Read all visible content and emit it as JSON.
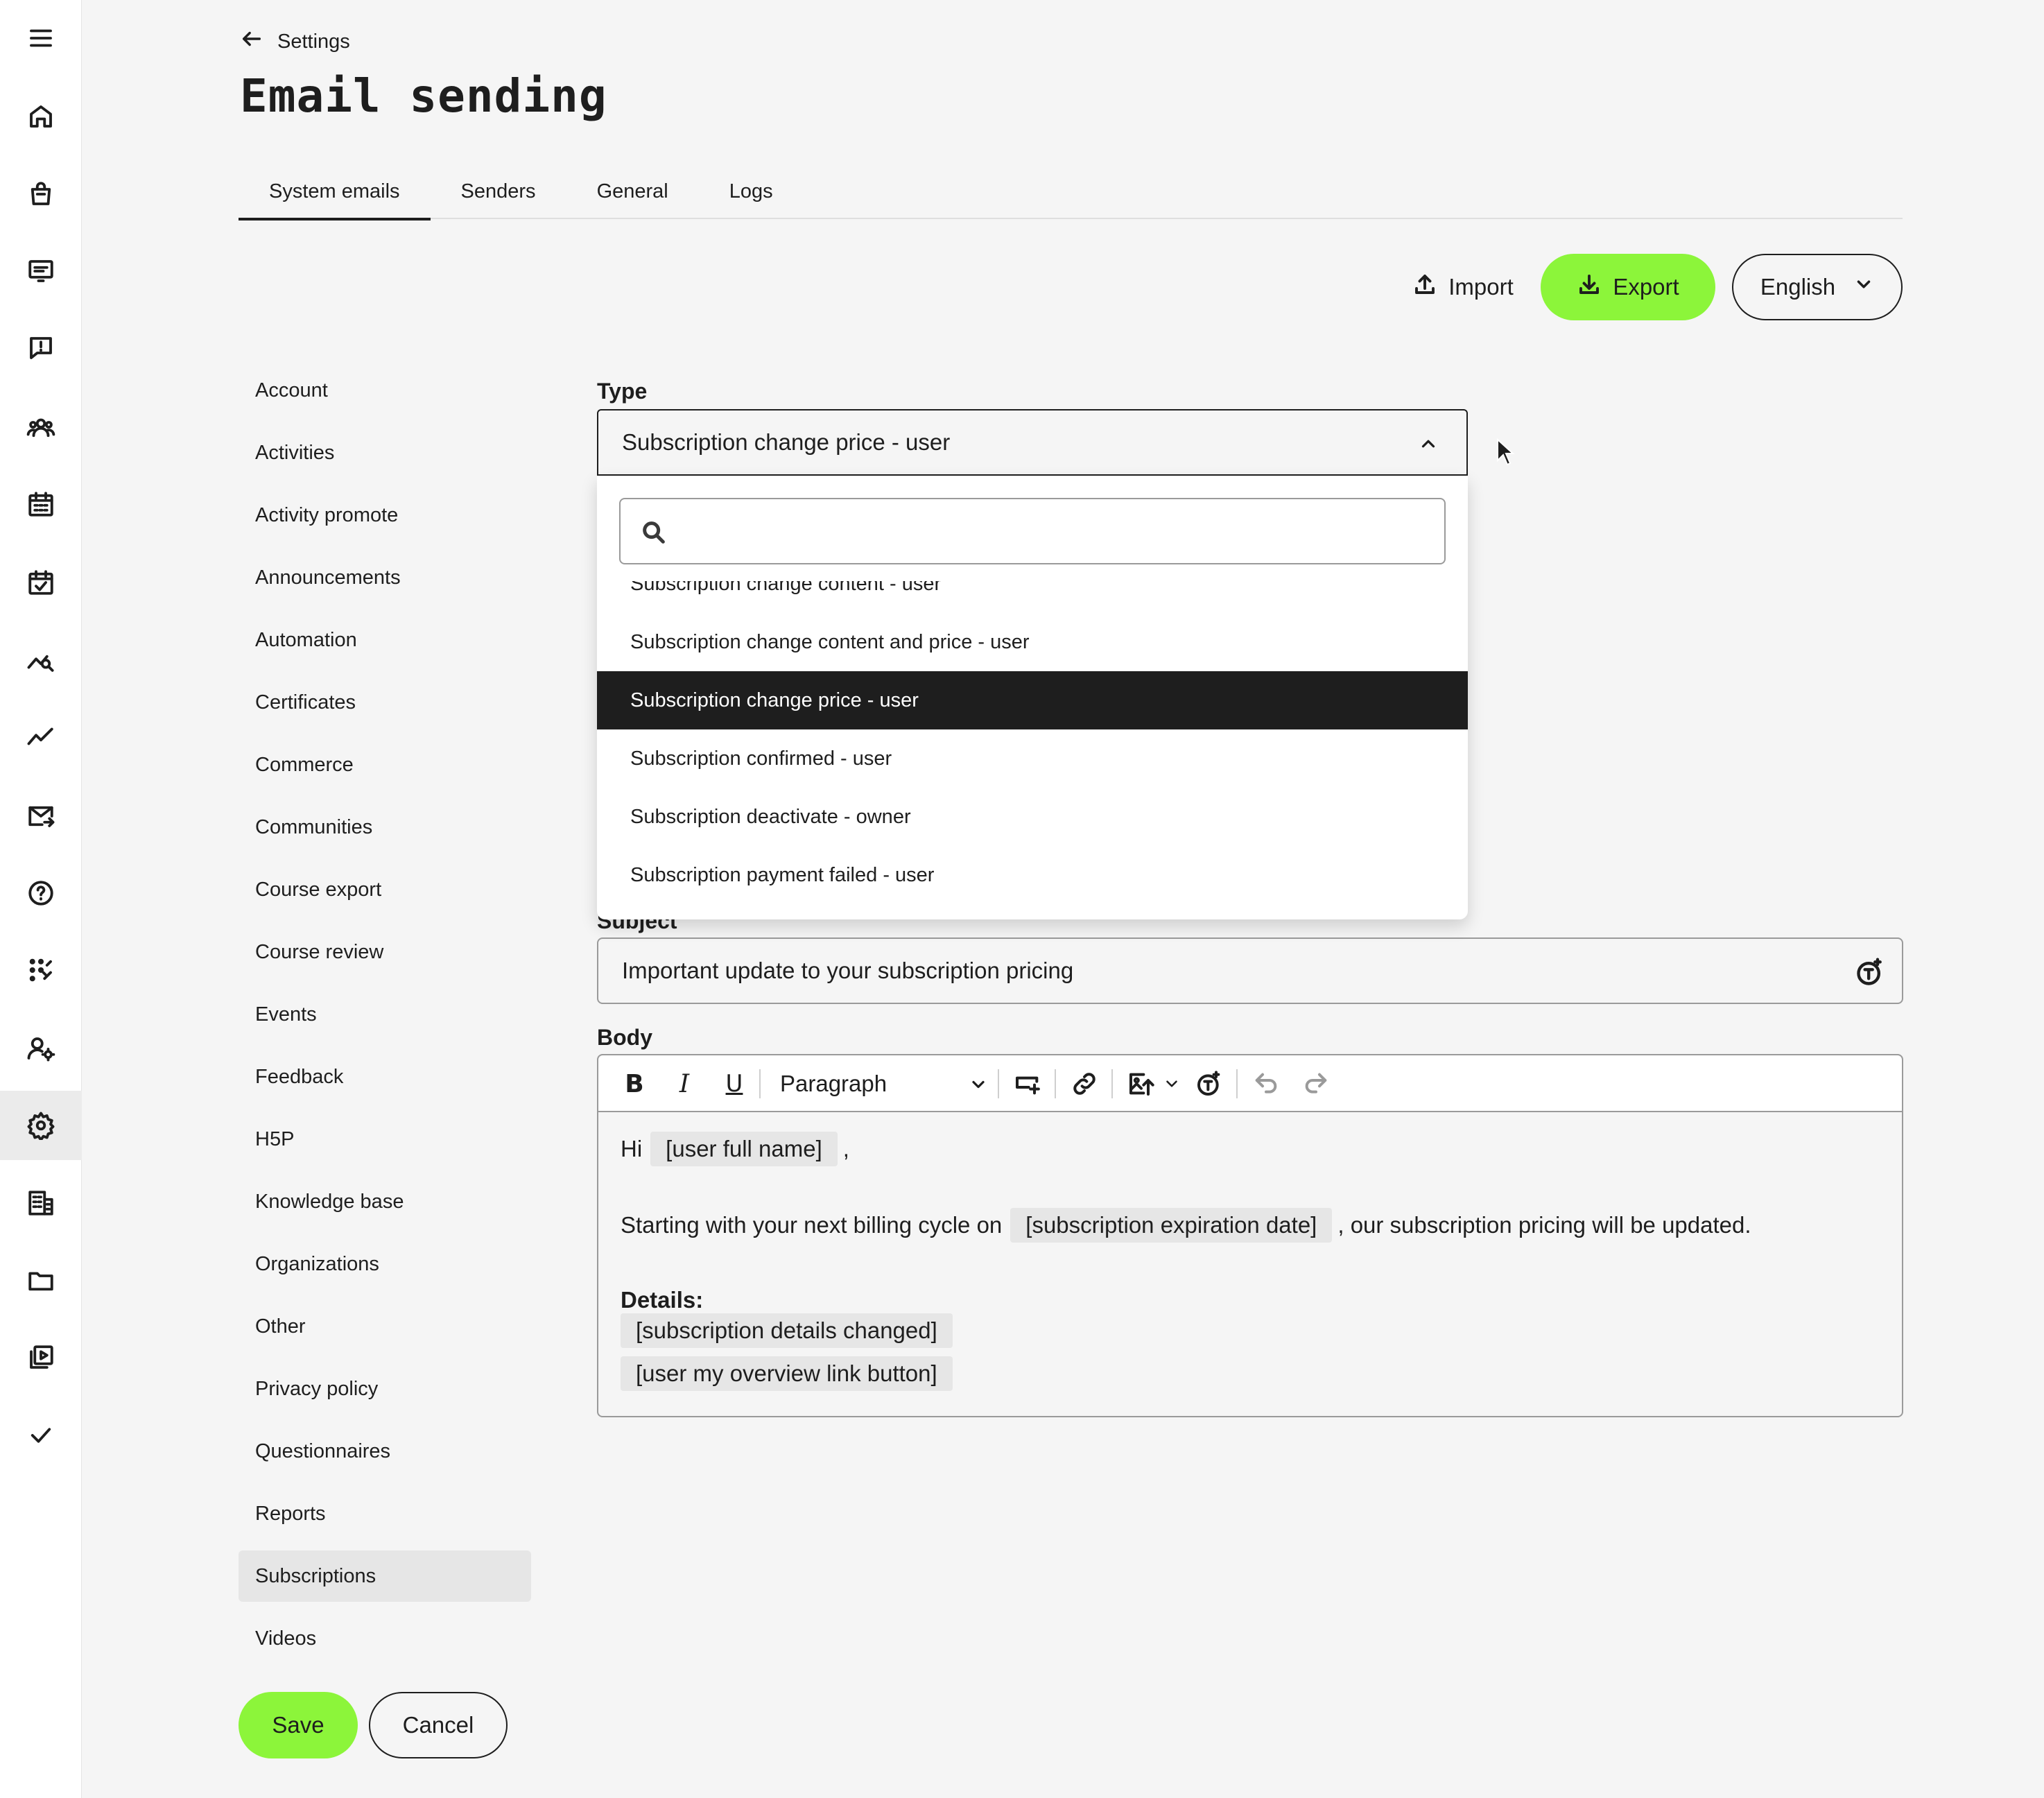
{
  "header": {
    "back_label": "Settings",
    "title": "Email sending"
  },
  "tabs": [
    {
      "label": "System emails",
      "active": true
    },
    {
      "label": "Senders",
      "active": false
    },
    {
      "label": "General",
      "active": false
    },
    {
      "label": "Logs",
      "active": false
    }
  ],
  "actions": {
    "import_label": "Import",
    "export_label": "Export",
    "language": "English"
  },
  "categories": [
    "Account",
    "Activities",
    "Activity promote",
    "Announcements",
    "Automation",
    "Certificates",
    "Commerce",
    "Communities",
    "Course export",
    "Course review",
    "Events",
    "Feedback",
    "H5P",
    "Knowledge base",
    "Organizations",
    "Other",
    "Privacy policy",
    "Questionnaires",
    "Reports",
    "Subscriptions",
    "Videos"
  ],
  "active_category": "Subscriptions",
  "form": {
    "type_label": "Type",
    "type_value": "Subscription change price - user",
    "search_value": "",
    "options": [
      "Subscription change content - user",
      "Subscription change content and price - user",
      "Subscription change price - user",
      "Subscription confirmed - user",
      "Subscription deactivate - owner",
      "Subscription payment failed - user"
    ],
    "selected_option": "Subscription change price - user",
    "subject_label": "Subject",
    "subject_value": "Important update to your subscription pricing",
    "body_label": "Body",
    "paragraph_style": "Paragraph",
    "body": {
      "greeting": "Hi",
      "greeting_token": "[user full name]",
      "greeting_suffix": ",",
      "line2_prefix": "Starting with your next billing cycle on",
      "line2_token": "[subscription expiration date]",
      "line2_suffix": ", our subscription pricing will be updated.",
      "details_heading": "Details:",
      "token_details": "[subscription details changed]",
      "token_link": "[user my overview link button]"
    }
  },
  "footer": {
    "save_label": "Save",
    "cancel_label": "Cancel"
  },
  "rail_icons": [
    "menu-icon",
    "home-icon",
    "shopping-bag-icon",
    "presentation-icon",
    "feedback-icon",
    "users-icon",
    "calendar-icon",
    "calendar-check-icon",
    "analytics-search-icon",
    "trend-icon",
    "mail-send-icon",
    "help-icon",
    "apps-icon",
    "user-settings-icon",
    "gear-icon",
    "building-icon",
    "folder-icon",
    "video-library-icon",
    "check-icon"
  ],
  "colors": {
    "accent": "#8cf53a",
    "selected_option_bg": "#1e1e1e",
    "background": "#f5f5f5"
  }
}
